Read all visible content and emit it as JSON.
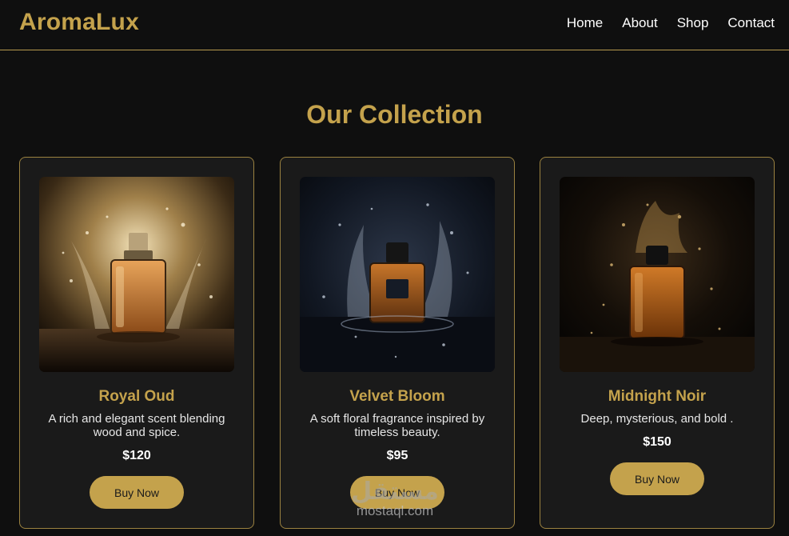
{
  "header": {
    "logo": "AromaLux",
    "nav": [
      "Home",
      "About",
      "Shop",
      "Contact"
    ]
  },
  "collection": {
    "title": "Our Collection",
    "products": [
      {
        "name": "Royal Oud",
        "description": "A rich and elegant scent blending wood and spice.",
        "price": "$120",
        "button": "Buy Now",
        "image": "royal-oud-perfume-bottle-image"
      },
      {
        "name": "Velvet Bloom",
        "description": "A soft floral fragrance inspired by timeless beauty.",
        "price": "$95",
        "button": "Buy Now",
        "image": "velvet-bloom-perfume-bottle-image"
      },
      {
        "name": "Midnight Noir",
        "description": "Deep, mysterious, and bold .",
        "price": "$150",
        "button": "Buy Now",
        "image": "midnight-noir-perfume-bottle-image"
      }
    ]
  },
  "watermark": {
    "arabic": "مستقل",
    "latin": "mostaql.com"
  },
  "colors": {
    "accent": "#c4a24c",
    "background": "#0f0f0f",
    "card": "#1a1a1a"
  }
}
